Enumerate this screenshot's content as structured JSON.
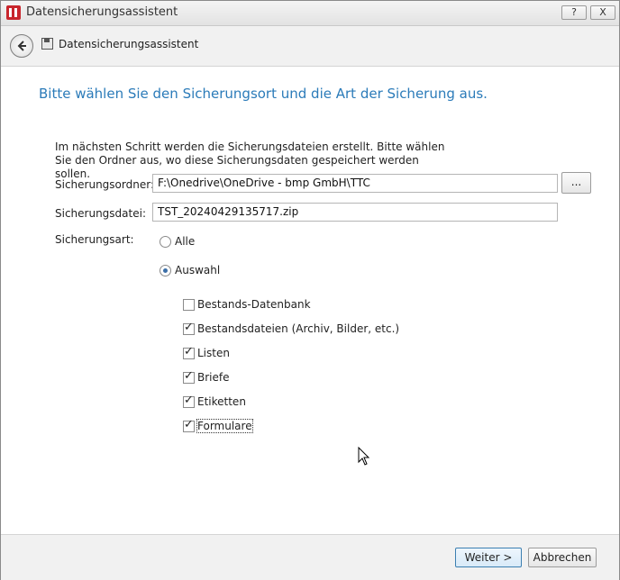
{
  "window": {
    "title": "Datensicherungsassistent",
    "help_label": "?",
    "close_label": "X"
  },
  "nav": {
    "title": "Datensicherungsassistent"
  },
  "main": {
    "heading": "Bitte wählen Sie den Sicherungsort und die Art der Sicherung aus.",
    "description": "Im nächsten Schritt werden die Sicherungsdateien erstellt. Bitte wählen Sie den Ordner aus, wo diese Sicherungsdaten gespeichert werden sollen.",
    "folder_label": "Sicherungsordner:",
    "folder_value": "F:\\Onedrive\\OneDrive - bmp GmbH\\TTC",
    "browse_label": "...",
    "file_label": "Sicherungsdatei:",
    "file_value": "TST_20240429135717.zip",
    "type_label": "Sicherungsart:",
    "radio_all": "Alle",
    "radio_selection": "Auswahl",
    "selected_type": "Auswahl",
    "options": [
      {
        "label": "Bestands-Datenbank",
        "checked": false
      },
      {
        "label": "Bestandsdateien (Archiv, Bilder, etc.)",
        "checked": true
      },
      {
        "label": "Listen",
        "checked": true
      },
      {
        "label": "Briefe",
        "checked": true
      },
      {
        "label": "Etiketten",
        "checked": true
      },
      {
        "label": "Formulare",
        "checked": true
      }
    ]
  },
  "footer": {
    "next_label": "Weiter >",
    "cancel_label": "Abbrechen"
  },
  "colors": {
    "heading": "#2b7bb9",
    "app_icon": "#c8252c"
  }
}
